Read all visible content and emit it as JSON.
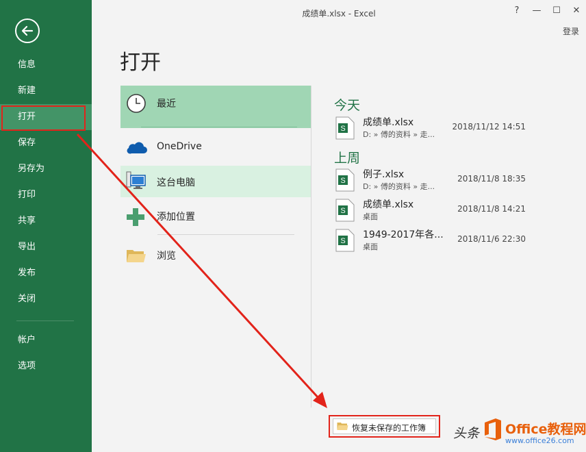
{
  "window": {
    "title": "成绩单.xlsx - Excel",
    "help": "?",
    "minimize": "—",
    "maximize": "☐",
    "close": "✕",
    "login": "登录"
  },
  "sidebar": {
    "items": [
      {
        "label": "信息"
      },
      {
        "label": "新建"
      },
      {
        "label": "打开",
        "active": true
      },
      {
        "label": "保存"
      },
      {
        "label": "另存为"
      },
      {
        "label": "打印"
      },
      {
        "label": "共享"
      },
      {
        "label": "导出"
      },
      {
        "label": "发布"
      },
      {
        "label": "关闭"
      },
      {
        "label": "帐户"
      },
      {
        "label": "选项"
      }
    ]
  },
  "page": {
    "heading": "打开"
  },
  "places": {
    "recent": "最近",
    "onedrive": "OneDrive",
    "this_pc": "这台电脑",
    "add_place": "添加位置",
    "browse": "浏览"
  },
  "recent_files": {
    "groups": [
      {
        "heading": "今天",
        "files": [
          {
            "name": "成绩单.xlsx",
            "path": "D: » 傅的资料 » 走...",
            "date": "2018/11/12 14:51"
          }
        ]
      },
      {
        "heading": "上周",
        "files": [
          {
            "name": "例子.xlsx",
            "path": "D: » 傅的资料 » 走...",
            "date": "2018/11/8 18:35"
          },
          {
            "name": "成绩单.xlsx",
            "path": "桌面",
            "date": "2018/11/8 14:21"
          },
          {
            "name": "1949-2017年各...",
            "path": "桌面",
            "date": "2018/11/6 22:30"
          }
        ]
      }
    ]
  },
  "recover_button": {
    "label": "恢复未保存的工作簿"
  },
  "watermark": {
    "left_text": "头条",
    "brand": "Office教程网",
    "url": "www.office26.com"
  },
  "colors": {
    "sidebar": "#217346",
    "sidebar_active": "#439467",
    "accent": "#217346",
    "annotation": "#e2231a"
  }
}
